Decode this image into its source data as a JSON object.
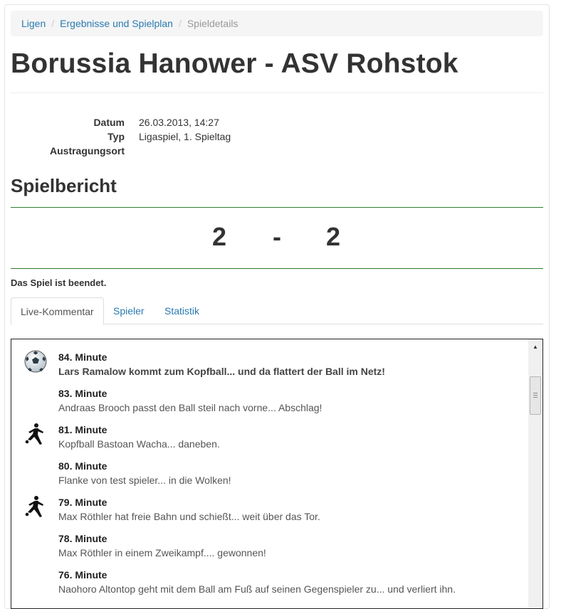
{
  "breadcrumb": {
    "items": [
      "Ligen",
      "Ergebnisse und Spielplan"
    ],
    "active": "Spieldetails",
    "separator": "/"
  },
  "match": {
    "title": "Borussia Hanower - ASV Rohstok"
  },
  "details": {
    "date_label": "Datum",
    "date_value": "26.03.2013, 14:27",
    "type_label": "Typ",
    "type_value": "Ligaspiel, 1. Spieltag",
    "venue_label": "Austragungsort",
    "venue_value": ""
  },
  "report": {
    "heading": "Spielbericht",
    "score_home": "2",
    "score_separator": "-",
    "score_away": "2",
    "status": "Das Spiel ist beendet."
  },
  "tabs": [
    {
      "label": "Live-Kommentar",
      "active": true
    },
    {
      "label": "Spieler",
      "active": false
    },
    {
      "label": "Statistik",
      "active": false
    }
  ],
  "commentary": [
    {
      "minute": "84. Minute",
      "text": "Lars Ramalow kommt zum Kopfball... und da flattert der Ball im Netz!",
      "icon": "soccer-ball-icon",
      "bold": true
    },
    {
      "minute": "83. Minute",
      "text": "Andraas Brooch passt den Ball steil nach vorne... Abschlag!",
      "icon": "",
      "bold": false
    },
    {
      "minute": "81. Minute",
      "text": "Kopfball Bastoan Wacha... daneben.",
      "icon": "player-kick-icon",
      "bold": false
    },
    {
      "minute": "80. Minute",
      "text": "Flanke von test spieler... in die Wolken!",
      "icon": "",
      "bold": false
    },
    {
      "minute": "79. Minute",
      "text": "Max Röthler hat freie Bahn und schießt... weit über das Tor.",
      "icon": "player-kick-icon",
      "bold": false
    },
    {
      "minute": "78. Minute",
      "text": "Max Röthler in einem Zweikampf.... gewonnen!",
      "icon": "",
      "bold": false
    },
    {
      "minute": "76. Minute",
      "text": "Naohoro Altontop geht mit dem Ball am Fuß auf seinen Gegenspieler zu... und verliert ihn.",
      "icon": "",
      "bold": false
    }
  ],
  "colors": {
    "link": "#2a7ab0",
    "divider_green": "#2e7d32"
  }
}
